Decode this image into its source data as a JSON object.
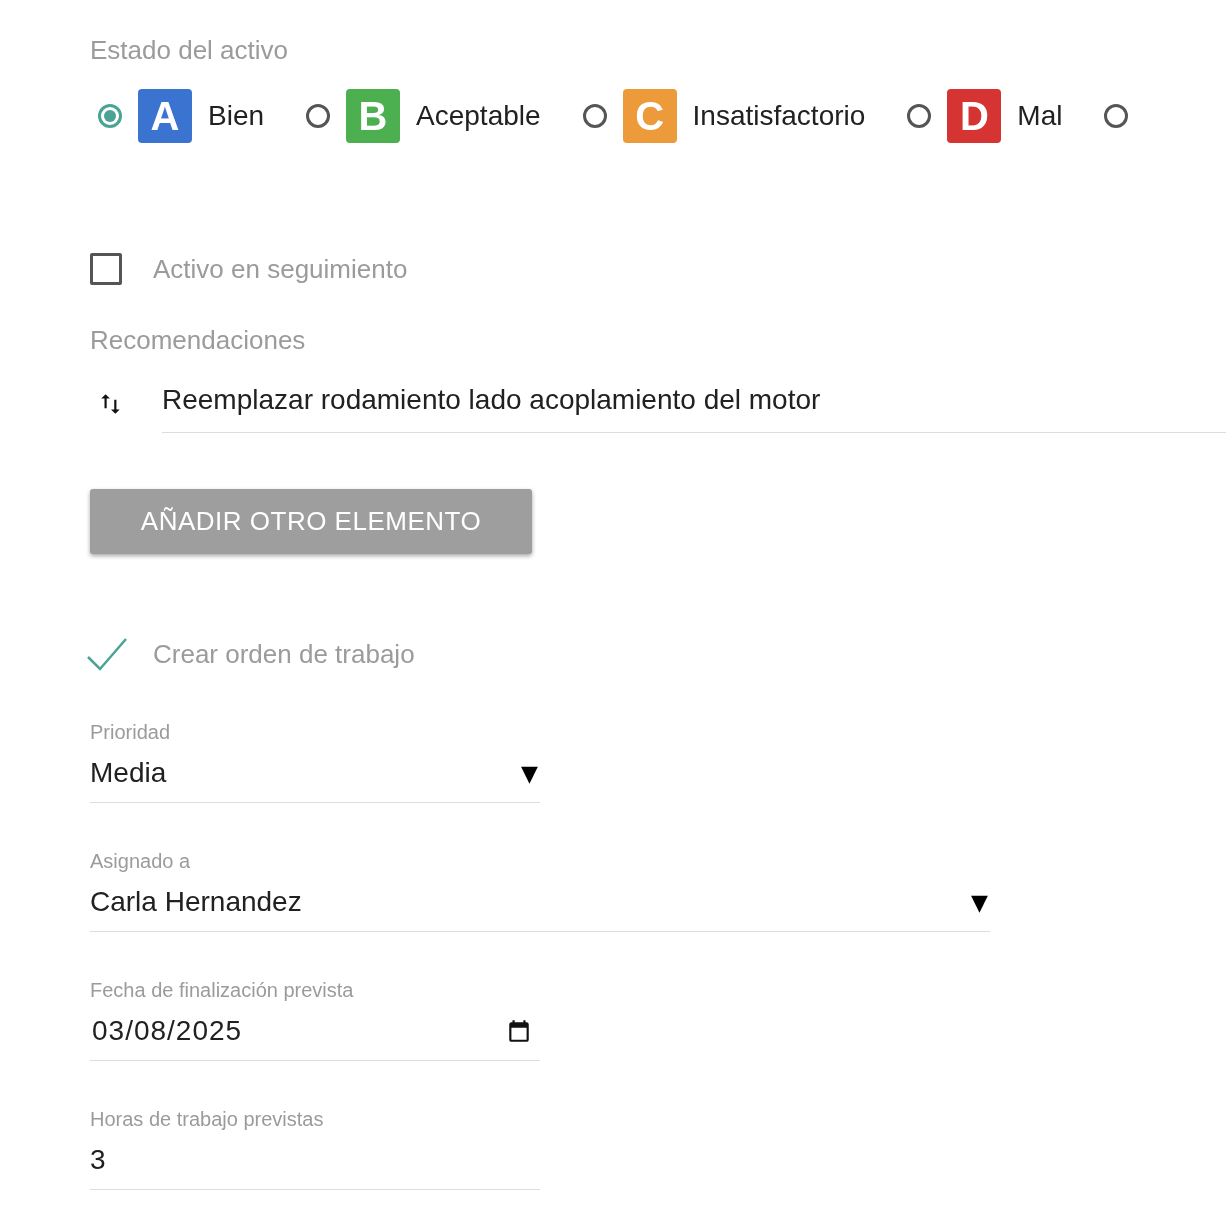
{
  "asset_status": {
    "label": "Estado del activo",
    "options": [
      {
        "letter": "A",
        "label": "Bien",
        "color": "#3a73d0",
        "selected": true
      },
      {
        "letter": "B",
        "label": "Aceptable",
        "color": "#4caf50",
        "selected": false
      },
      {
        "letter": "C",
        "label": "Insatisfactorio",
        "color": "#ec9a3a",
        "selected": false
      },
      {
        "letter": "D",
        "label": "Mal",
        "color": "#d63333",
        "selected": false
      },
      {
        "selected": false
      }
    ]
  },
  "tracking": {
    "label": "Activo en seguimiento",
    "checked": false
  },
  "recommendations": {
    "label": "Recomendaciones",
    "items": [
      {
        "text": "Reemplazar rodamiento lado acoplamiento del motor"
      }
    ],
    "add_button": "AÑADIR OTRO ELEMENTO"
  },
  "work_order": {
    "label": "Crear orden de trabajo",
    "checked": true
  },
  "fields": [
    {
      "kind": "select",
      "label": "Prioridad",
      "value": "Media",
      "arrow": "▼",
      "wide": false
    },
    {
      "kind": "select",
      "label": "Asignado a",
      "value": "Carla Hernandez",
      "arrow": "▼",
      "wide": true
    },
    {
      "kind": "date",
      "label": "Fecha de finalización prevista",
      "value": "03/08/2025",
      "wide": false
    },
    {
      "kind": "text",
      "label": "Horas de trabajo previstas",
      "value": "3",
      "wide": false
    }
  ]
}
